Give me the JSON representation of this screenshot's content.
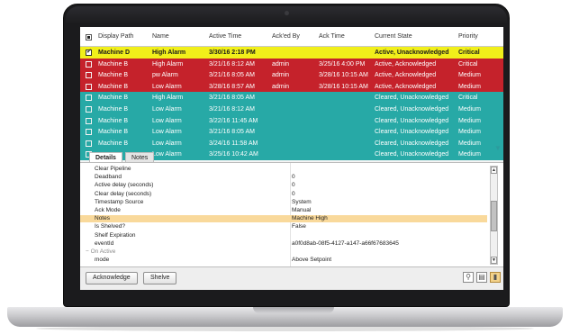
{
  "colors": {
    "yellow_row": "#f1ef1a",
    "red_row": "#c5222b",
    "teal_row": "#27a9a6",
    "notes_highlight": "#f9d99b"
  },
  "table": {
    "headers": [
      "Display Path",
      "Name",
      "Active Time",
      "Ack'ed By",
      "Ack Time",
      "Current State",
      "Priority"
    ],
    "rows": [
      {
        "style": "yellow",
        "checked": true,
        "path": "Machine D",
        "name": "High Alarm",
        "time": "3/30/16 2:18 PM",
        "ackby": "",
        "acktime": "",
        "state": "Active, Unacknowledged",
        "prio": "Critical"
      },
      {
        "style": "red",
        "checked": false,
        "path": "Machine B",
        "name": "High Alarm",
        "time": "3/21/16 8:12 AM",
        "ackby": "admin",
        "acktime": "3/25/16 4:00 PM",
        "state": "Active, Acknowledged",
        "prio": "Critical"
      },
      {
        "style": "red",
        "checked": false,
        "path": "Machine B",
        "name": "pw Alarm",
        "time": "3/21/16 8:05 AM",
        "ackby": "admin",
        "acktime": "3/28/16 10:15 AM",
        "state": "Active, Acknowledged",
        "prio": "Medium"
      },
      {
        "style": "red",
        "checked": false,
        "path": "Machine B",
        "name": "Low Alarm",
        "time": "3/28/16 8:57 AM",
        "ackby": "admin",
        "acktime": "3/28/16 10:15 AM",
        "state": "Active, Acknowledged",
        "prio": "Medium"
      },
      {
        "style": "teal",
        "checked": false,
        "path": "Machine B",
        "name": "High Alarm",
        "time": "3/21/16 8:05 AM",
        "ackby": "",
        "acktime": "",
        "state": "Cleared, Unacknowledged",
        "prio": "Critical"
      },
      {
        "style": "teal",
        "checked": false,
        "path": "Machine B",
        "name": "Low Alarm",
        "time": "3/21/16 8:12 AM",
        "ackby": "",
        "acktime": "",
        "state": "Cleared, Unacknowledged",
        "prio": "Medium"
      },
      {
        "style": "teal",
        "checked": false,
        "path": "Machine B",
        "name": "Low Alarm",
        "time": "3/22/16 11:45 AM",
        "ackby": "",
        "acktime": "",
        "state": "Cleared, Unacknowledged",
        "prio": "Medium"
      },
      {
        "style": "teal",
        "checked": false,
        "path": "Machine B",
        "name": "Low Alarm",
        "time": "3/21/16 8:05 AM",
        "ackby": "",
        "acktime": "",
        "state": "Cleared, Unacknowledged",
        "prio": "Medium"
      },
      {
        "style": "teal",
        "checked": false,
        "path": "Machine B",
        "name": "Low Alarm",
        "time": "3/24/16 11:58 AM",
        "ackby": "",
        "acktime": "",
        "state": "Cleared, Unacknowledged",
        "prio": "Medium"
      },
      {
        "style": "teal",
        "checked": false,
        "path": "",
        "name": "Low Alarm",
        "time": "3/25/16 10:42 AM",
        "ackby": "",
        "acktime": "",
        "state": "Cleared, Unacknowledged",
        "prio": "Medium"
      }
    ]
  },
  "tabs": {
    "details": "Details",
    "notes": "Notes"
  },
  "details": [
    {
      "key": "Clear Pipeline",
      "value": "",
      "kind": "row"
    },
    {
      "key": "Deadband",
      "value": "0",
      "kind": "row"
    },
    {
      "key": "Active delay (seconds)",
      "value": "0",
      "kind": "row"
    },
    {
      "key": "Clear delay (seconds)",
      "value": "0",
      "kind": "row"
    },
    {
      "key": "Timestamp Source",
      "value": "System",
      "kind": "row"
    },
    {
      "key": "Ack Mode",
      "value": "Manual",
      "kind": "row"
    },
    {
      "key": "Notes",
      "value": "Machine High",
      "kind": "highlight"
    },
    {
      "key": "Is Shelved?",
      "value": "False",
      "kind": "row"
    },
    {
      "key": "Shelf Expiration",
      "value": "",
      "kind": "row"
    },
    {
      "key": "eventId",
      "value": "a0f0d8ab-08f5-4127-a147-a66f67683645",
      "kind": "row"
    },
    {
      "key": "On Active",
      "value": "",
      "kind": "group"
    },
    {
      "key": "mode",
      "value": "Above Setpoint",
      "kind": "row"
    }
  ],
  "buttons": {
    "acknowledge": "Acknowledge",
    "shelve": "Shelve"
  }
}
